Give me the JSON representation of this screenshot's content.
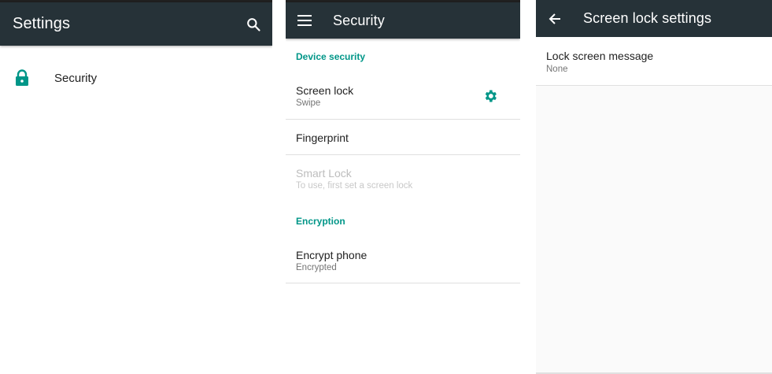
{
  "settings_screen": {
    "title": "Settings",
    "search_icon": "search-icon",
    "items": [
      {
        "label": "Security",
        "icon": "lock-icon"
      }
    ]
  },
  "security_screen": {
    "title": "Security",
    "menu_icon": "menu-icon",
    "sections": [
      {
        "header": "Device security",
        "items": [
          {
            "title": "Screen lock",
            "summary": "Swipe",
            "trailing_icon": "gear-icon"
          },
          {
            "title": "Fingerprint",
            "summary": ""
          },
          {
            "title": "Smart Lock",
            "summary": "To use, first set a screen lock",
            "disabled": true
          }
        ]
      },
      {
        "header": "Encryption",
        "items": [
          {
            "title": "Encrypt phone",
            "summary": "Encrypted"
          }
        ]
      }
    ]
  },
  "lock_settings_screen": {
    "title": "Screen lock settings",
    "back_icon": "back-arrow-icon",
    "items": [
      {
        "title": "Lock screen message",
        "summary": "None"
      }
    ]
  },
  "colors": {
    "appbar": "#263238",
    "accent": "#009688"
  }
}
